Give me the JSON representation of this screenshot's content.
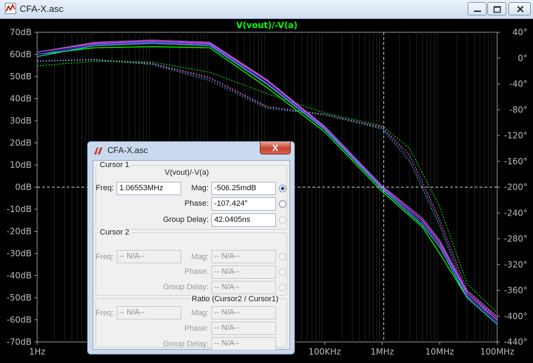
{
  "window": {
    "title": "CFA-X.asc"
  },
  "plot": {
    "trace_label": "V(vout)/-V(a)"
  },
  "chart_data": {
    "type": "line",
    "title": "V(vout)/-V(a)",
    "x_scale": "log",
    "x_range_hz": [
      1,
      100000000
    ],
    "x_ticks": [
      "1Hz",
      "",
      "",
      "",
      "",
      "100KHz",
      "1MHz",
      "10MHz",
      "100MHz"
    ],
    "y_left_ticks": [
      "70dB",
      "60dB",
      "50dB",
      "40dB",
      "30dB",
      "20dB",
      "10dB",
      "0dB",
      "-10dB",
      "-20dB",
      "-30dB",
      "-40dB",
      "-50dB",
      "-60dB",
      "-70dB"
    ],
    "y_left_range_db": [
      -70,
      70
    ],
    "y_right_ticks": [
      "40°",
      "0°",
      "-40°",
      "-80°",
      "-120°",
      "-160°",
      "-200°",
      "-240°",
      "-280°",
      "-320°",
      "-360°",
      "-400°",
      "-440°"
    ],
    "y_right_range_deg": [
      -440,
      40
    ],
    "cursor": {
      "freq_hz": 1065530,
      "mag_db": 0
    },
    "magnitude_series": [
      {
        "color": "#00ff00",
        "points": [
          [
            1,
            60
          ],
          [
            10,
            63
          ],
          [
            100,
            63.5
          ],
          [
            1000,
            63
          ],
          [
            10000,
            45
          ],
          [
            100000,
            25
          ],
          [
            1000000,
            -2
          ],
          [
            5000000,
            -18
          ],
          [
            10000000,
            -30
          ],
          [
            30000000,
            -50
          ],
          [
            100000000,
            -62
          ]
        ]
      },
      {
        "color": "#ff44ff",
        "points": [
          [
            1,
            61
          ],
          [
            10,
            65
          ],
          [
            100,
            66
          ],
          [
            1000,
            65
          ],
          [
            10000,
            48
          ],
          [
            100000,
            27
          ],
          [
            1000000,
            0
          ],
          [
            5000000,
            -15
          ],
          [
            10000000,
            -25
          ],
          [
            30000000,
            -48
          ],
          [
            100000000,
            -60
          ]
        ]
      },
      {
        "color": "#4040ff",
        "points": [
          [
            1,
            60
          ],
          [
            10,
            64.5
          ],
          [
            100,
            65.5
          ],
          [
            1000,
            64.5
          ],
          [
            10000,
            47
          ],
          [
            100000,
            26.5
          ],
          [
            1000000,
            -0.5
          ],
          [
            5000000,
            -16
          ],
          [
            10000000,
            -26
          ],
          [
            30000000,
            -49
          ],
          [
            100000000,
            -61
          ]
        ]
      },
      {
        "color": "#30c0c0",
        "points": [
          [
            1,
            59
          ],
          [
            10,
            64
          ],
          [
            100,
            65
          ],
          [
            1000,
            64
          ],
          [
            10000,
            46.5
          ],
          [
            100000,
            26
          ],
          [
            1000000,
            -1
          ],
          [
            5000000,
            -17
          ],
          [
            10000000,
            -27
          ],
          [
            30000000,
            -50
          ],
          [
            100000000,
            -62
          ]
        ]
      },
      {
        "color": "#8c5ab4",
        "points": [
          [
            1,
            61
          ],
          [
            10,
            65.5
          ],
          [
            100,
            66.5
          ],
          [
            1000,
            65.5
          ],
          [
            10000,
            48.5
          ],
          [
            100000,
            27.5
          ],
          [
            1000000,
            0.5
          ],
          [
            5000000,
            -14
          ],
          [
            10000000,
            -24
          ],
          [
            30000000,
            -47
          ],
          [
            100000000,
            -59
          ]
        ]
      }
    ],
    "phase_series": [
      {
        "color": "#ff66ff",
        "points": [
          [
            1,
            -5
          ],
          [
            10,
            -2
          ],
          [
            100,
            -8
          ],
          [
            1000,
            -30
          ],
          [
            10000,
            -75
          ],
          [
            100000,
            -87
          ],
          [
            1000000,
            -107
          ],
          [
            3000000,
            -150
          ],
          [
            10000000,
            -250
          ],
          [
            30000000,
            -360
          ],
          [
            100000000,
            -400
          ]
        ]
      },
      {
        "color": "#30c0c0",
        "points": [
          [
            1,
            -5
          ],
          [
            10,
            -3
          ],
          [
            100,
            -10
          ],
          [
            1000,
            -35
          ],
          [
            10000,
            -78
          ],
          [
            100000,
            -88
          ],
          [
            1000000,
            -110
          ],
          [
            3000000,
            -160
          ],
          [
            10000000,
            -260
          ],
          [
            30000000,
            -370
          ],
          [
            100000000,
            -405
          ]
        ]
      },
      {
        "color": "#8c5ab4",
        "points": [
          [
            1,
            -4
          ],
          [
            10,
            -2
          ],
          [
            100,
            -9
          ],
          [
            1000,
            -32
          ],
          [
            10000,
            -76
          ],
          [
            100000,
            -87.5
          ],
          [
            1000000,
            -108
          ],
          [
            3000000,
            -155
          ],
          [
            10000000,
            -255
          ],
          [
            30000000,
            -365
          ],
          [
            100000000,
            -402
          ]
        ]
      },
      {
        "color": "#00ff00",
        "points": [
          [
            1,
            -12
          ],
          [
            10,
            -5
          ],
          [
            100,
            -6
          ],
          [
            1000,
            -22
          ],
          [
            10000,
            -55
          ],
          [
            100000,
            -85
          ],
          [
            1000000,
            -105
          ],
          [
            3000000,
            -140
          ],
          [
            10000000,
            -230
          ],
          [
            30000000,
            -350
          ],
          [
            100000000,
            -395
          ]
        ]
      }
    ]
  },
  "cursor_dialog": {
    "title": "CFA-X.asc",
    "close_label": "X",
    "cursor1": {
      "group_label": "Cursor 1",
      "expression": "V(vout)/-V(a)",
      "freq_label": "Freq:",
      "freq_value": "1.06553MHz",
      "mag_label": "Mag:",
      "mag_value": "-506.25mdB",
      "phase_label": "Phase:",
      "phase_value": "-107.424°",
      "gd_label": "Group Delay:",
      "gd_value": "42.0405ns"
    },
    "cursor2": {
      "group_label": "Cursor 2",
      "freq_label": "Freq:",
      "freq_value": "-- N/A--",
      "mag_label": "Mag:",
      "mag_value": "-- N/A--",
      "phase_label": "Phase:",
      "phase_value": "-- N/A--",
      "gd_label": "Group Delay:",
      "gd_value": "-- N/A--"
    },
    "ratio": {
      "group_label": "Ratio (Cursor2 / Cursor1)",
      "freq_label": "Freq:",
      "freq_value": "-- N/A--",
      "mag_label": "Mag:",
      "mag_value": "-- N/A--",
      "phase_label": "Phase:",
      "phase_value": "-- N/A--",
      "gd_label": "Group Delay:",
      "gd_value": "-- N/A--"
    }
  }
}
